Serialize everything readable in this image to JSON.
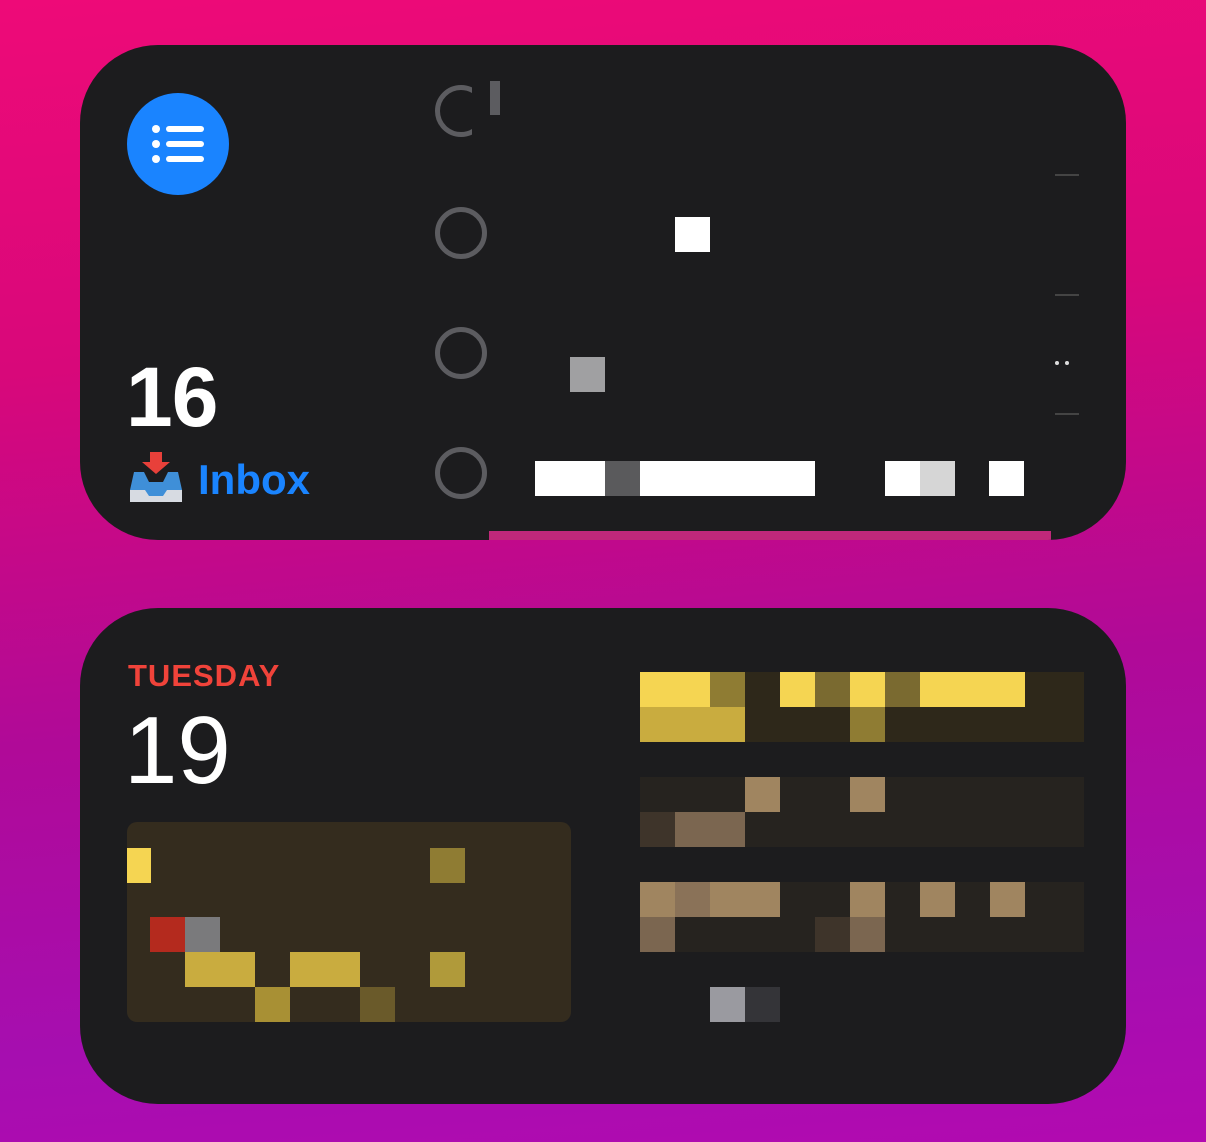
{
  "reminders": {
    "list_icon": "list-bullet-icon",
    "count": "16",
    "list_icon_emoji": "📥",
    "list_name": "Inbox",
    "accent_color": "#1a84ff"
  },
  "calendar": {
    "weekday": "TUESDAY",
    "day": "19",
    "accent_color": "#f0433a"
  }
}
